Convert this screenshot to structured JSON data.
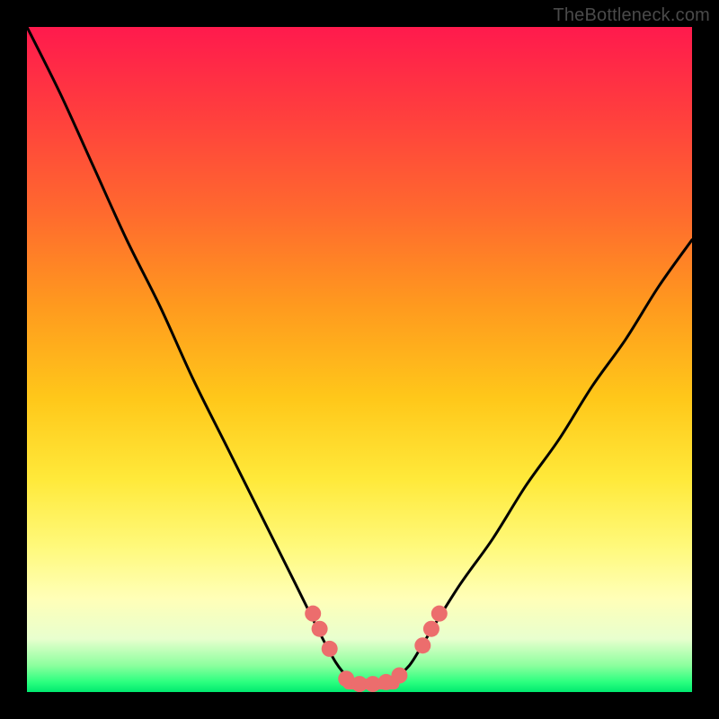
{
  "watermark": "TheBottleneck.com",
  "chart_data": {
    "type": "line",
    "title": "",
    "xlabel": "",
    "ylabel": "",
    "xlim": [
      0,
      1
    ],
    "ylim": [
      0,
      1
    ],
    "legend": false,
    "grid": false,
    "series": [
      {
        "name": "bottleneck-curve",
        "x": [
          0.0,
          0.05,
          0.1,
          0.15,
          0.2,
          0.25,
          0.3,
          0.35,
          0.4,
          0.45,
          0.475,
          0.5,
          0.525,
          0.55,
          0.575,
          0.6,
          0.65,
          0.7,
          0.75,
          0.8,
          0.85,
          0.9,
          0.95,
          1.0
        ],
        "y": [
          1.0,
          0.9,
          0.79,
          0.68,
          0.58,
          0.47,
          0.37,
          0.27,
          0.17,
          0.07,
          0.03,
          0.01,
          0.01,
          0.02,
          0.04,
          0.08,
          0.16,
          0.23,
          0.31,
          0.38,
          0.46,
          0.53,
          0.61,
          0.68
        ]
      }
    ],
    "markers": {
      "name": "highlight-points",
      "color": "#ec6d6d",
      "points": [
        {
          "x": 0.43,
          "y": 0.118
        },
        {
          "x": 0.44,
          "y": 0.095
        },
        {
          "x": 0.455,
          "y": 0.065
        },
        {
          "x": 0.48,
          "y": 0.02
        },
        {
          "x": 0.5,
          "y": 0.012
        },
        {
          "x": 0.52,
          "y": 0.012
        },
        {
          "x": 0.54,
          "y": 0.015
        },
        {
          "x": 0.56,
          "y": 0.025
        },
        {
          "x": 0.595,
          "y": 0.07
        },
        {
          "x": 0.608,
          "y": 0.095
        },
        {
          "x": 0.62,
          "y": 0.118
        }
      ],
      "bar": {
        "x0": 0.475,
        "x1": 0.56,
        "y": 0.012
      }
    }
  }
}
